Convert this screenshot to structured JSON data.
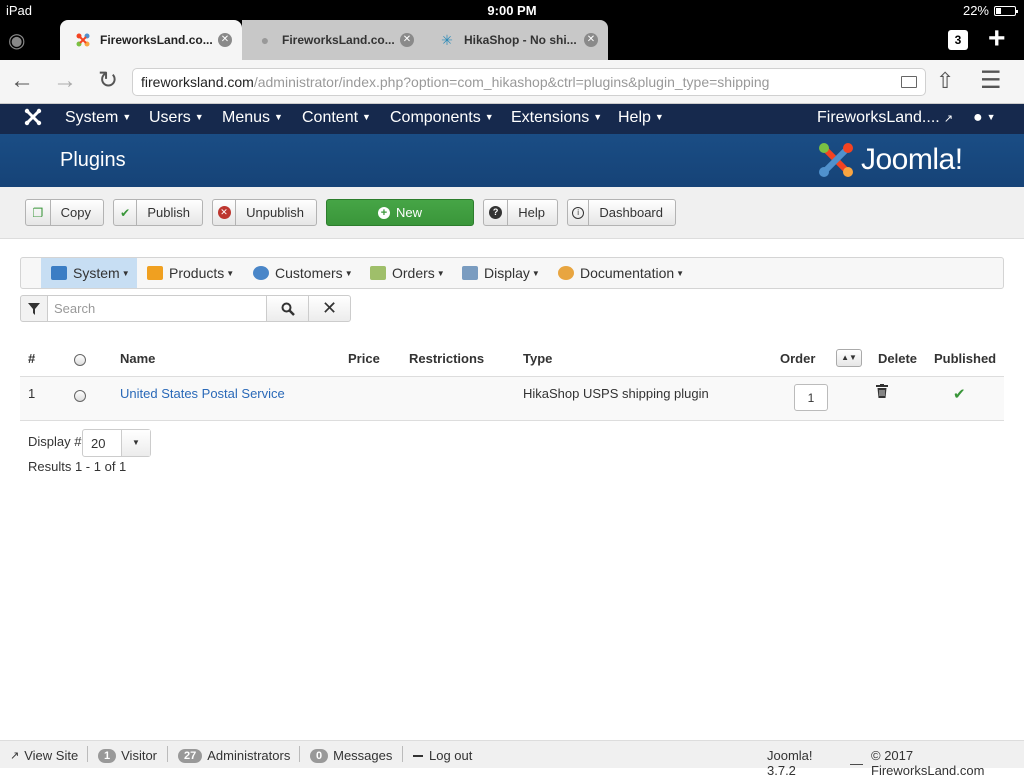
{
  "status_bar": {
    "device": "iPad",
    "time": "9:00 PM",
    "battery": "22%"
  },
  "tabs": [
    {
      "title": "FireworksLand.co...",
      "active": true,
      "icon": "joomla-favicon"
    },
    {
      "title": "FireworksLand.co...",
      "active": false,
      "icon": "globe-favicon"
    },
    {
      "title": "HikaShop - No shi...",
      "active": false,
      "icon": "hikashop-favicon"
    }
  ],
  "tab_count": "3",
  "url": {
    "domain": "fireworksland.com",
    "path": "/administrator/index.php?option=com_hikashop&ctrl=plugins&plugin_type=shipping"
  },
  "topnav": {
    "items": [
      "System",
      "Users",
      "Menus",
      "Content",
      "Components",
      "Extensions",
      "Help"
    ],
    "site_name": "FireworksLand....",
    "user_icon": "user-icon"
  },
  "header": {
    "title": "Plugins",
    "logo_text": "Joomla!"
  },
  "toolbar": {
    "copy": "Copy",
    "publish": "Publish",
    "unpublish": "Unpublish",
    "new": "New",
    "help": "Help",
    "dashboard": "Dashboard"
  },
  "hikamenu": {
    "items": [
      "System",
      "Products",
      "Customers",
      "Orders",
      "Display",
      "Documentation"
    ],
    "active": "System"
  },
  "search": {
    "placeholder": "Search"
  },
  "table": {
    "columns": [
      "#",
      "",
      "Name",
      "Price",
      "Restrictions",
      "Type",
      "Order",
      "Delete",
      "Published"
    ],
    "rows": [
      {
        "num": "1",
        "name": "United States Postal Service",
        "price": "",
        "restrictions": "",
        "type": "HikaShop USPS shipping plugin",
        "order": "1",
        "published": true
      }
    ]
  },
  "pagination": {
    "display_label": "Display #",
    "display_value": "20",
    "results": "Results 1 - 1 of 1"
  },
  "footer": {
    "view_site": "View Site",
    "visitor_count": "1",
    "visitor_label": "Visitor",
    "admin_count": "27",
    "admin_label": "Administrators",
    "messages_count": "0",
    "messages_label": "Messages",
    "logout": "Log out",
    "version": "Joomla! 3.7.2",
    "dash": "—",
    "copyright": "© 2017 FireworksLand.com"
  },
  "colors": {
    "topnav": "#16294d",
    "header": "#1a4d85",
    "new_button": "#46a546",
    "link": "#2a69b8",
    "published": "#3a963a"
  }
}
